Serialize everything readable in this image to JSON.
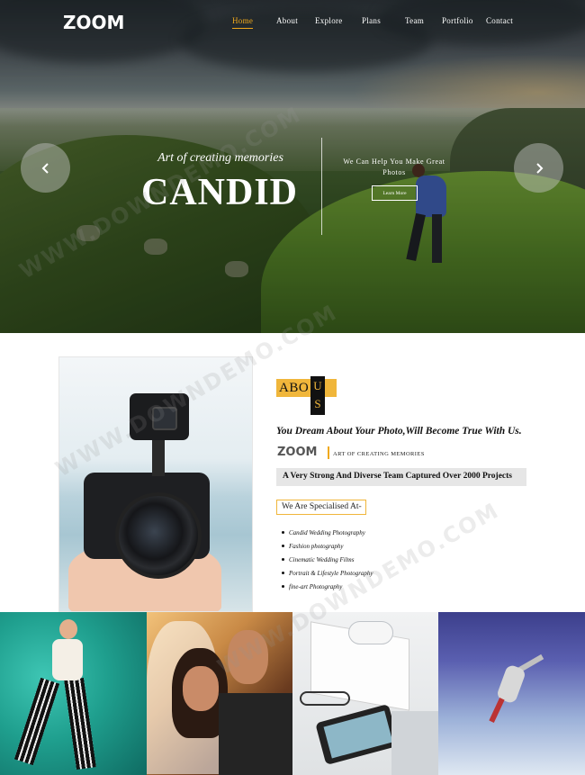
{
  "brand": {
    "logo": "ZOOM"
  },
  "nav": {
    "items": [
      {
        "label": "Home",
        "active": true
      },
      {
        "label": "About",
        "active": false
      },
      {
        "label": "Explore",
        "active": false
      },
      {
        "label": "Plans",
        "active": false
      },
      {
        "label": "Team",
        "active": false
      },
      {
        "label": "Portfolio",
        "active": false
      },
      {
        "label": "Contact",
        "active": false
      }
    ],
    "active_color": "#f0a91c"
  },
  "hero": {
    "tagline": "Art of creating memories",
    "title": "CANDID",
    "subtitle": "We Can Help You Make Great Photos",
    "button_label": "Learn More",
    "prev_icon": "chevron-left-icon",
    "next_icon": "chevron-right-icon"
  },
  "about": {
    "title_part1": "ABO",
    "title_part2": "U\nS",
    "headline": "You Dream About Your Photo,Will Become True With Us.",
    "mini_logo": "ZOOM",
    "mini_tagline": "ART OF CREATING MEMORIES",
    "team_statement": "A Very Strong And Diverse Team Captured Over 2000 Projects",
    "specialised_label": "We Are Specialised At-",
    "specialities": [
      "Candid Wedding Photography",
      "Fashion photography",
      "Cinematic Wedding Films",
      "Portrait & Lifestyle Photography",
      "fine-art Photography"
    ],
    "accent_color": "#f0b63b"
  },
  "watermark": "WWW.DOWNDEMO.COM"
}
